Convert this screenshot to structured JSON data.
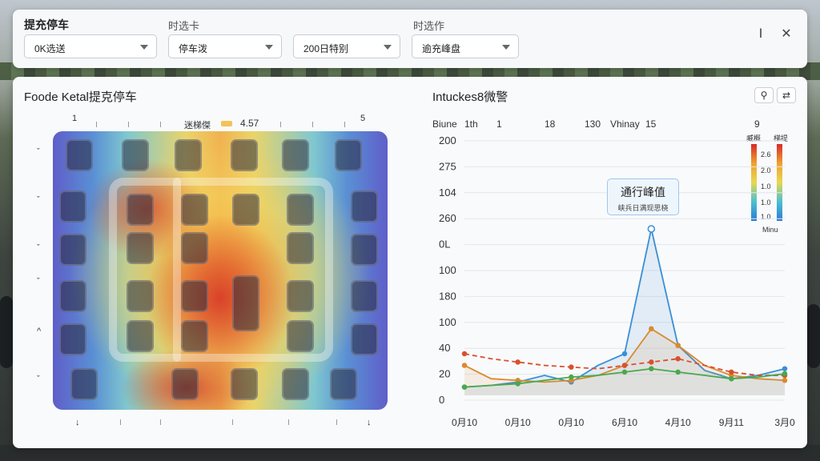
{
  "filters": {
    "title": "提充停车",
    "time_label_1": "时选卡",
    "time_label_2": "时选作",
    "selects": [
      {
        "value": "0K选送"
      },
      {
        "value": "停车泼"
      },
      {
        "value": "200日特别"
      },
      {
        "value": "逾充峰盘"
      }
    ],
    "win_btn_1": "Ⅰ",
    "win_btn_2": "✕"
  },
  "heatmap": {
    "title": "Foode Ketal提克停车",
    "legend_label": "迷梯傑",
    "legend_value": "4.57",
    "top_marks": [
      "1",
      "5"
    ],
    "left_marks": [
      "ˇ",
      "ˇ",
      "ˇ",
      "ˇ",
      "^",
      "ˇ"
    ],
    "bottom_marks": [
      "↓",
      "↓"
    ]
  },
  "chart": {
    "title": "Intuckes8微警",
    "header_ticks": [
      "Biune",
      "1th",
      "1",
      "18",
      "130",
      "Vhinay",
      "15",
      "9"
    ],
    "search_icon": "search-icon",
    "collapse_icon": "collapse-icon",
    "callout_title": "通行峰值",
    "callout_sub": "峡兵日满现思桡",
    "legend_cols": [
      {
        "head": "臧概",
        "ticks": [
          "2.6",
          "2.0",
          "1.0",
          "1.0",
          "1.0"
        ]
      },
      {
        "head": "梯提",
        "ticks": []
      }
    ],
    "legend_footer": "Minu"
  },
  "chart_data": {
    "type": "line",
    "y_tick_labels": [
      "200",
      "275",
      "104",
      "260",
      "0L",
      "100",
      "180",
      "100",
      "40",
      "20",
      "0"
    ],
    "categories": [
      "0月10",
      "0月10",
      "0月10",
      "6月10",
      "4月10",
      "9月11",
      "3月0"
    ],
    "series": [
      {
        "color": "#3a8fd6",
        "values": [
          5,
          6,
          8,
          12,
          8,
          18,
          25,
          100,
          30,
          15,
          10,
          12,
          16
        ]
      },
      {
        "color": "#d98a2e",
        "values": [
          18,
          10,
          9,
          8,
          9,
          12,
          18,
          40,
          30,
          18,
          12,
          10,
          9
        ]
      },
      {
        "color": "#d9502e",
        "values": [
          25,
          22,
          20,
          18,
          17,
          16,
          18,
          20,
          22,
          18,
          14,
          12,
          12
        ]
      },
      {
        "color": "#4aa84a",
        "values": [
          5,
          6,
          7,
          9,
          11,
          12,
          14,
          16,
          14,
          12,
          10,
          11,
          13
        ]
      }
    ],
    "peak_index": 7,
    "grid": true
  }
}
